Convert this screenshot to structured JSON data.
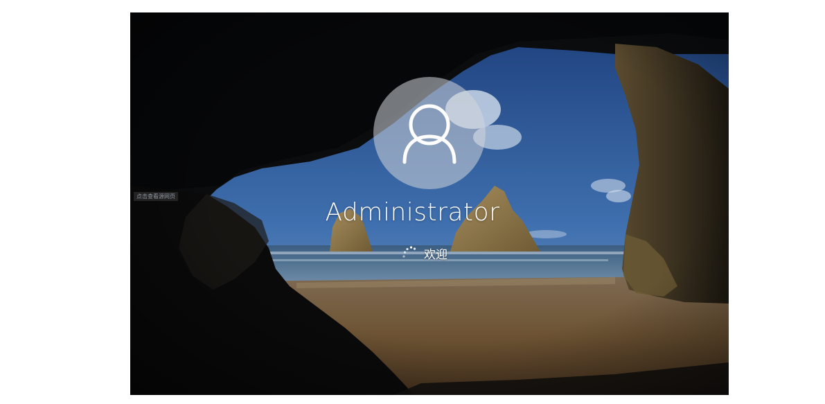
{
  "login_screen": {
    "username": "Administrator",
    "status_text": "欢迎",
    "side_label": "点击查看源网页",
    "icons": {
      "avatar": "user-silhouette-icon",
      "spinner": "loading-dots-icon"
    },
    "colors": {
      "text": "#ffffff",
      "avatar_background": "#d2d6da"
    }
  }
}
